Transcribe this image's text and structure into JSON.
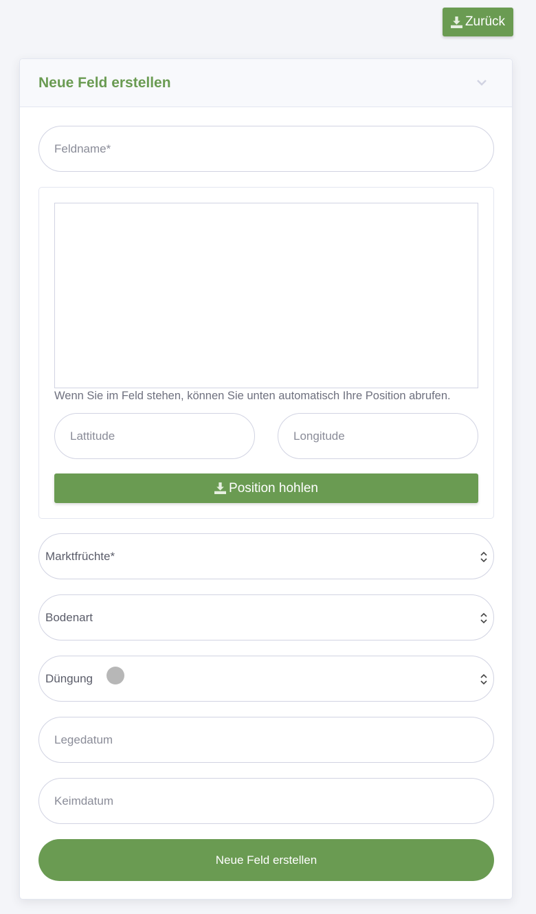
{
  "toolbar": {
    "back_label": "Zurück"
  },
  "card": {
    "title": "Neue Feld erstellen",
    "fields": {
      "feldname_placeholder": "Feldname*",
      "lat_placeholder": "Lattitude",
      "lng_placeholder": "Longitude",
      "legedatum_placeholder": "Legedatum",
      "keimdatum_placeholder": "Keimdatum"
    },
    "map": {
      "hint": "Wenn Sie im Feld stehen, können Sie unten automatisch Ihre Position abrufen.",
      "position_button": "Position hohlen"
    },
    "selects": {
      "marktfruechte": "Marktfrüchte*",
      "bodenart": "Bodenart",
      "duengung": "Düngung"
    },
    "submit_label": "Neue Feld erstellen"
  },
  "colors": {
    "accent": "#6a9b52",
    "background": "#f4f5f9",
    "border": "#d1d3e2"
  },
  "icons": [
    "download-icon",
    "chevron-down-icon",
    "select-caret-icon"
  ]
}
